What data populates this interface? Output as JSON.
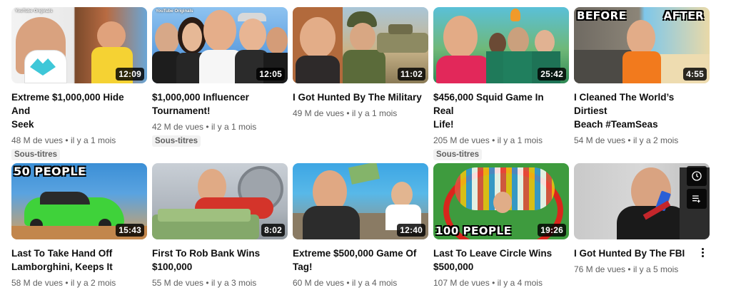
{
  "rows": [
    [
      {
        "title_line1": "Extreme $1,000,000 Hide And",
        "title_line2": "Seek",
        "views": "48 M de vues",
        "age": "il y a 1 mois",
        "duration": "12:09",
        "badge": "Sous-titres",
        "overlay": "",
        "channel_tag": "YouTube Originals"
      },
      {
        "title_line1": "$1,000,000 Influencer",
        "title_line2": "Tournament!",
        "views": "42 M de vues",
        "age": "il y a 1 mois",
        "duration": "12:05",
        "badge": "Sous-titres",
        "overlay": "",
        "channel_tag": "YouTube Originals"
      },
      {
        "title_line1": "I Got Hunted By The Military",
        "title_line2": "",
        "views": "49 M de vues",
        "age": "il y a 1 mois",
        "duration": "11:02",
        "badge": "",
        "overlay": "",
        "channel_tag": ""
      },
      {
        "title_line1": "$456,000 Squid Game In Real",
        "title_line2": "Life!",
        "views": "205 M de vues",
        "age": "il y a 1 mois",
        "duration": "25:42",
        "badge": "Sous-titres",
        "overlay": "",
        "channel_tag": ""
      },
      {
        "title_line1": "I Cleaned The World’s Dirtiest",
        "title_line2": "Beach #TeamSeas",
        "views": "54 M de vues",
        "age": "il y a 2 mois",
        "duration": "4:55",
        "badge": "",
        "overlay_left": "BEFORE",
        "overlay_right": "AFTER",
        "channel_tag": ""
      }
    ],
    [
      {
        "title_line1": "Last To Take Hand Off",
        "title_line2": "Lamborghini, Keeps It",
        "views": "58 M de vues",
        "age": "il y a 2 mois",
        "duration": "15:43",
        "badge": "",
        "overlay": "50 PEOPLE",
        "channel_tag": ""
      },
      {
        "title_line1": "First To Rob Bank Wins",
        "title_line2": "$100,000",
        "views": "55 M de vues",
        "age": "il y a 3 mois",
        "duration": "8:02",
        "badge": "",
        "overlay": "",
        "channel_tag": ""
      },
      {
        "title_line1": "Extreme $500,000 Game Of",
        "title_line2": "Tag!",
        "views": "60 M de vues",
        "age": "il y a 4 mois",
        "duration": "12:40",
        "badge": "",
        "overlay": "",
        "channel_tag": ""
      },
      {
        "title_line1": "Last To Leave Circle Wins",
        "title_line2": "$500,000",
        "views": "107 M de vues",
        "age": "il y a 4 mois",
        "duration": "19:26",
        "badge": "",
        "overlay": "100 PEOPLE",
        "channel_tag": ""
      },
      {
        "title_line1": "I Got Hunted By The FBI",
        "title_line2": "",
        "views": "76 M de vues",
        "age": "il y a 5 mois",
        "duration": "",
        "badge": "",
        "overlay": "",
        "channel_tag": ""
      }
    ]
  ],
  "separator": "•",
  "icons": {
    "more": "more-vert-icon",
    "watch_later": "clock-icon",
    "add_to_queue": "queue-icon"
  }
}
